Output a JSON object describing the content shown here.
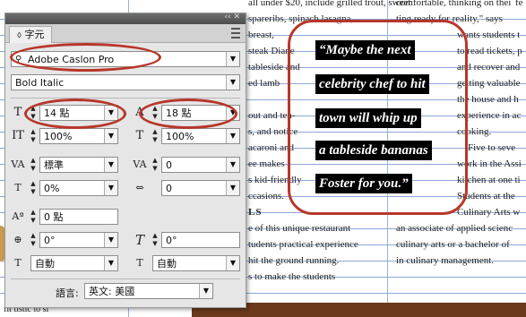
{
  "document": {
    "left_col": [
      "all under $20, include grilled trout, sweet",
      "spareribs, spinach lasagna,",
      "breast,",
      "steak Diane",
      "tableside and",
      "ed lamb",
      "out and ten-",
      "s, and notice",
      "acaroni and",
      "ee makes",
      "s kid-friendly",
      "ccasions.",
      "LS",
      "e of this unique restaurant",
      "tudents practical experience",
      "hit the ground running.",
      "s to make the students"
    ],
    "right_col": [
      "comfortable, thinking on thei",
      "ting ready for reality,\" says",
      "wants students t",
      "to read tickets, p",
      "and recover and",
      "getting valuable",
      "the house and h",
      "experience in ac",
      "cooking.",
      "Five to seve",
      "work in the Assi",
      "kitchen at one ti",
      "Students at the",
      "Culinary Arts w",
      "an associate of applied scienc",
      "culinary arts or a bachelor of",
      "in culinary management."
    ],
    "bottom_left": "fit tistic lo sl",
    "top_right_fragment": "fe",
    "quote_lines": [
      "“Maybe the next",
      "celebrity chef to hit",
      "town will whip up",
      "a tableside bananas",
      "Foster for you.”"
    ]
  },
  "panel": {
    "title_controls": "‹‹ ✕",
    "tab_label": "⬨ 字元",
    "font_family": "Adobe Caslon Pro",
    "font_style": "Bold Italic",
    "font_size": "14 點",
    "leading": "18 點",
    "vertical_scale": "100%",
    "horizontal_scale": "100%",
    "kerning": "標準",
    "tracking": "0",
    "baseline_shift_pct": "0%",
    "char_spacing": "0",
    "baseline_shift": "0 點",
    "rotation": "0°",
    "skew": "0°",
    "auto_1": "自動",
    "auto_2": "自動",
    "language_label": "語言:",
    "language_value": "英文: 美國"
  },
  "colors": {
    "annotation": "#b7372a",
    "guide": "#8ea6d6",
    "quote_bg": "#000000",
    "quote_text": "#ffffff"
  }
}
